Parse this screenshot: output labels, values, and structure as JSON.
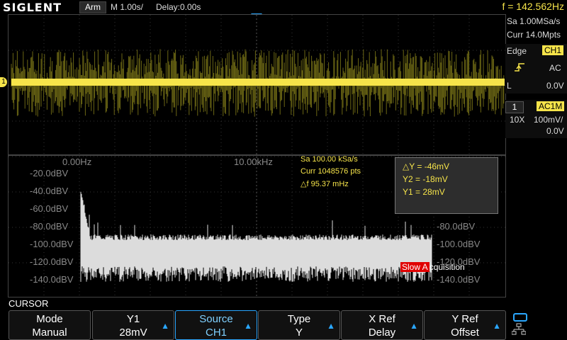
{
  "brand": "SIGLENT",
  "status": "Arm",
  "timebase": "M 1.00s/",
  "delay": "Delay:0.00s",
  "frequency": "f = 142.562Hz",
  "right_panel": {
    "sample_rate": "Sa 1.00MSa/s",
    "memory_depth": "Curr 14.0Mpts",
    "trigger_type": "Edge",
    "trigger_source": "CH1",
    "trigger_slope_icon": "rising-edge-icon",
    "trigger_coupling": "AC",
    "trigger_level_label": "L",
    "trigger_level": "0.0V",
    "channel_number": "1",
    "channel_coupling": "AC1M",
    "probe": "10X",
    "volts_div": "100mV/",
    "offset": "0.0V"
  },
  "ch1_marker": "1",
  "fft": {
    "x_start": "0.00Hz",
    "x_mid": "10.00kHz",
    "sample": "Sa 100.00 kSa/s",
    "points": "Curr 1048576 pts",
    "delta_f": "△f 95.37 mHz",
    "left_scale": [
      "-20.0dBV",
      "-40.0dBV",
      "-60.0dBV",
      "-80.0dBV",
      "-100.0dBV",
      "-120.0dBV",
      "-140.0dBV"
    ],
    "right_scale": [
      "-80.0dBV",
      "-100.0dBV",
      "-120.0dBV",
      "-140.0dBV"
    ]
  },
  "cursor_box": {
    "dy": "△Y = -46mV",
    "y2": "Y2 = -18mV",
    "y1": "Y1 = 28mV"
  },
  "slow_acq": {
    "red": "Slow A",
    "rest": "cquisition"
  },
  "menu": {
    "title": "CURSOR",
    "buttons": [
      {
        "l1": "Mode",
        "l2": "Manual",
        "arrow": false
      },
      {
        "l1": "Y1",
        "l2": "28mV",
        "arrow": true
      },
      {
        "l1": "Source",
        "l2": "CH1",
        "arrow": true
      },
      {
        "l1": "Type",
        "l2": "Y",
        "arrow": true
      },
      {
        "l1": "X Ref",
        "l2": "Delay",
        "arrow": true
      },
      {
        "l1": "Y Ref",
        "l2": "Offset",
        "arrow": true
      }
    ]
  },
  "colors": {
    "ch1": "#f6e44a",
    "accent": "#2aa7ff",
    "fft": "#dcdcdc",
    "warn": "#e00000"
  }
}
